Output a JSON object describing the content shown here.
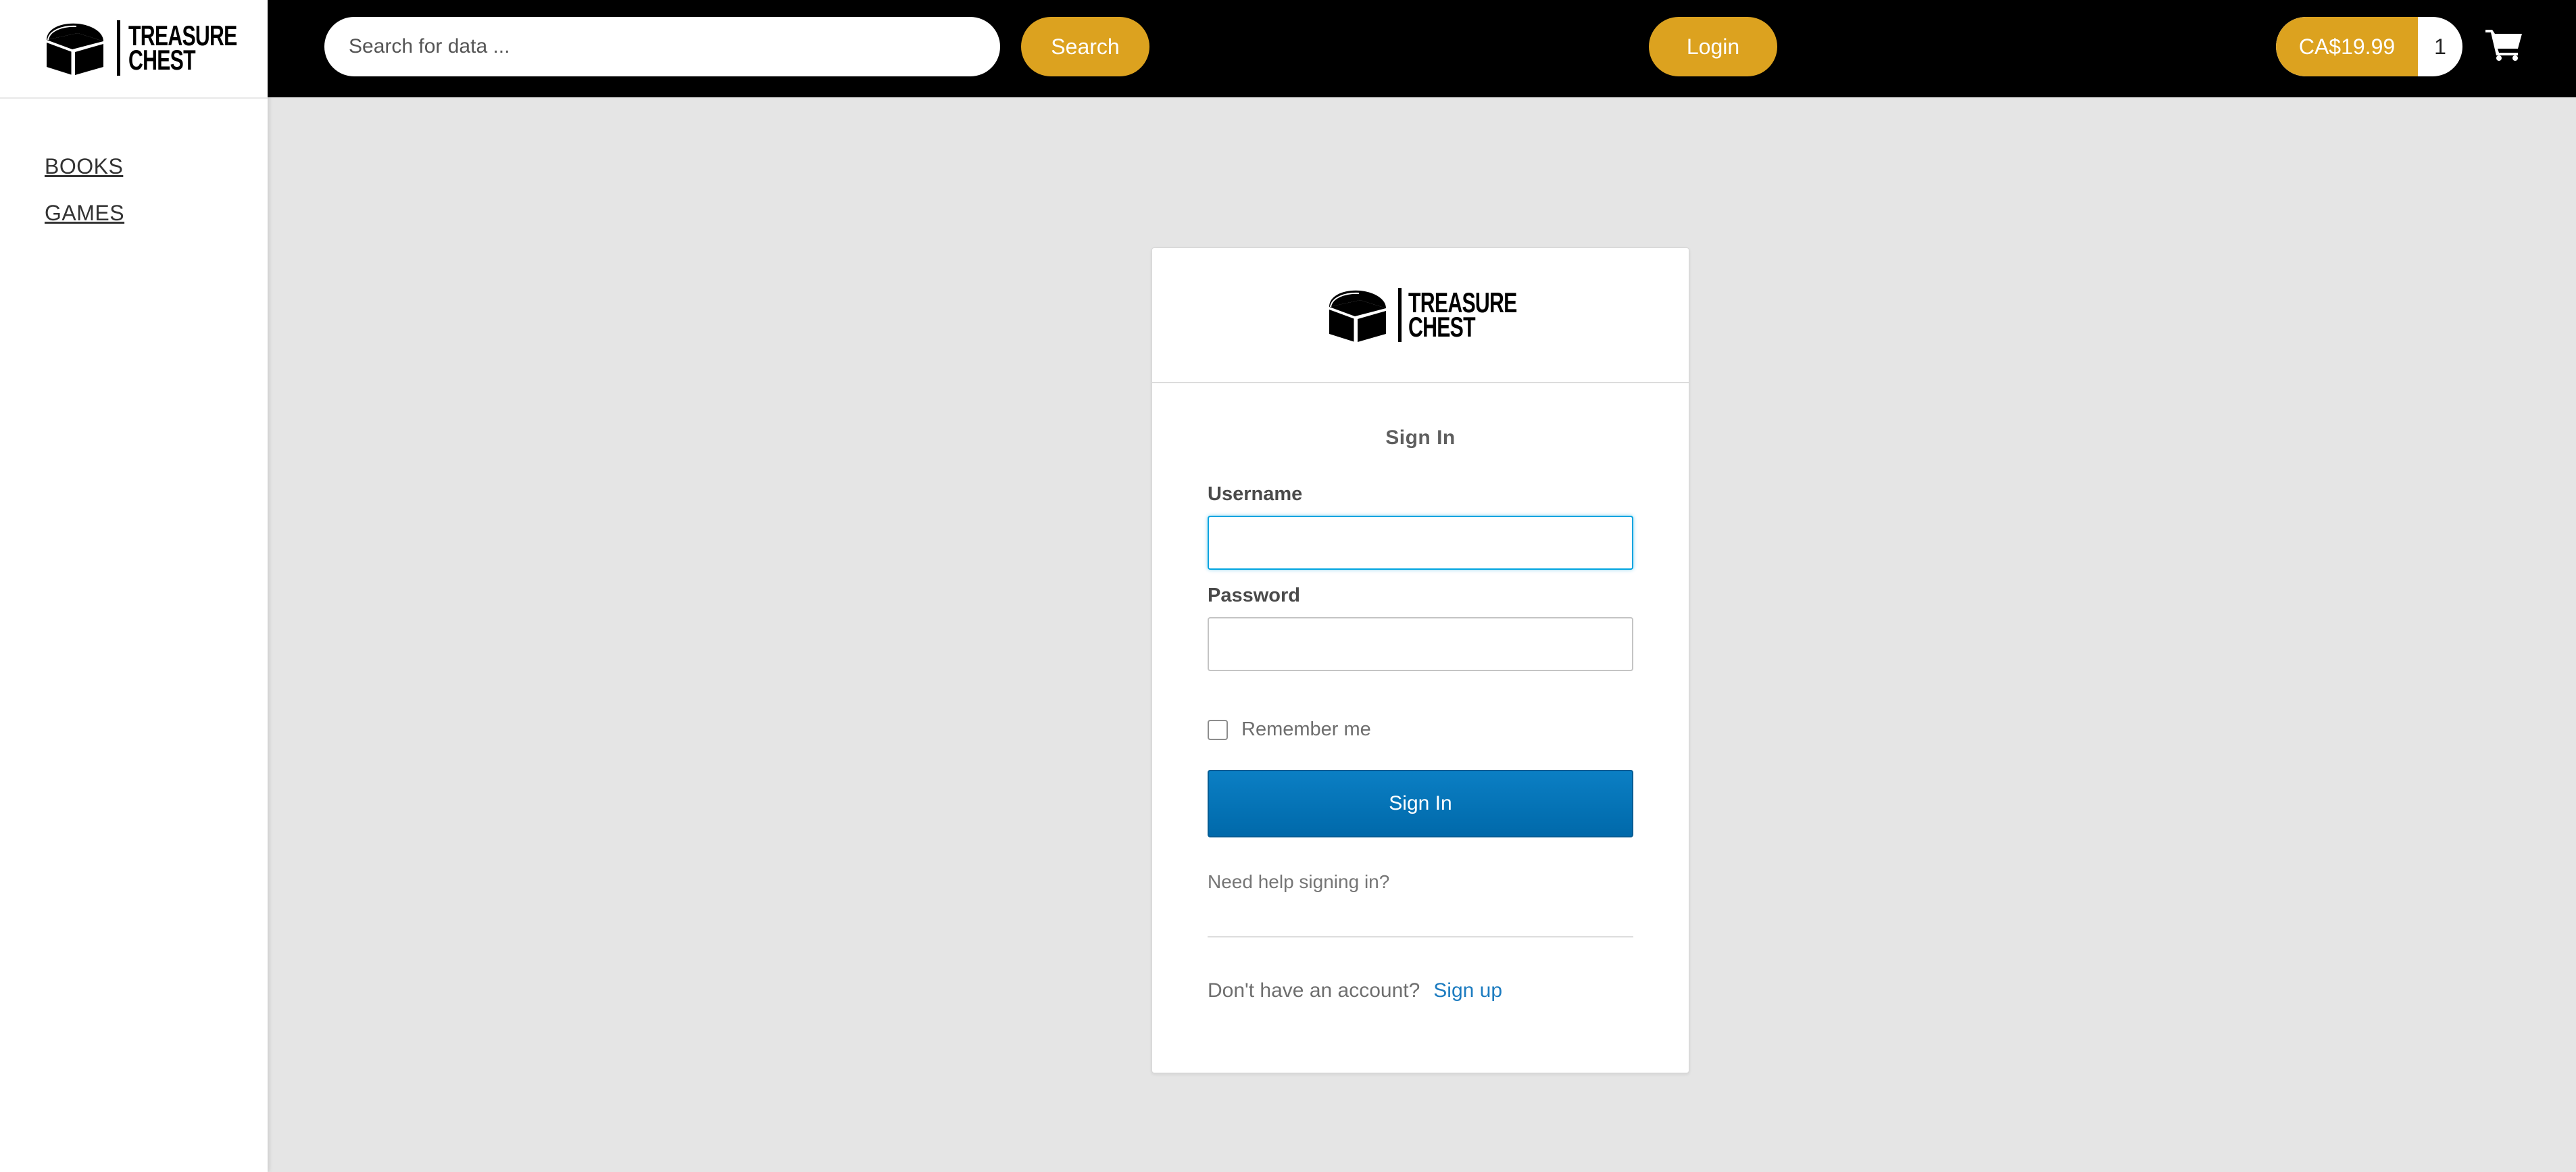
{
  "brand": {
    "line1": "TREASURE",
    "line2": "CHEST",
    "logo_icon": "treasure-chest-icon"
  },
  "sidebar": {
    "items": [
      {
        "label": "BOOKS"
      },
      {
        "label": "GAMES"
      }
    ]
  },
  "header": {
    "search": {
      "placeholder": "Search for data ...",
      "value": ""
    },
    "search_label": "Search",
    "login_label": "Login",
    "cart": {
      "price": "CA$19.99",
      "count": "1",
      "icon": "shopping-cart-icon"
    }
  },
  "signin": {
    "title": "Sign In",
    "username_label": "Username",
    "username_value": "",
    "password_label": "Password",
    "password_value": "",
    "remember_label": "Remember me",
    "remember_checked": false,
    "submit_label": "Sign In",
    "help_link": "Need help signing in?",
    "no_account_text": "Don't have an account?",
    "signup_link": "Sign up"
  },
  "colors": {
    "accent": "#dca21f",
    "primary_button": "#0b7fc4",
    "focus": "#00a4e0",
    "link": "#1d7cc0",
    "topbar": "#000000",
    "page_background": "#e5e5e5"
  }
}
